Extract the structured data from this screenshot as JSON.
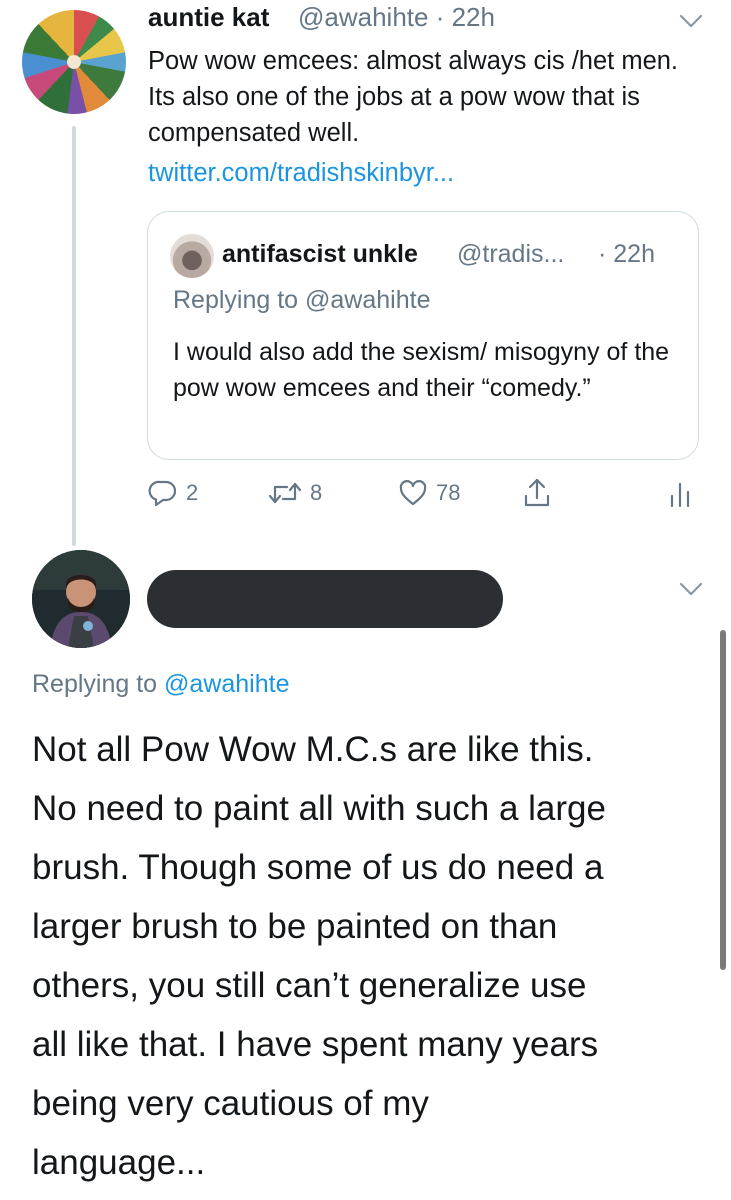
{
  "tweet1": {
    "display_name": "auntie kat",
    "handle_time": "@awahihte · 22h",
    "text": "Pow wow emcees: almost always cis /het men. Its also one of the jobs at a pow wow that is compensated well.",
    "link": "twitter.com/tradishskinbyr...",
    "quote": {
      "display_name": "antifascist unkle",
      "handle": "@tradis...",
      "time": "· 22h",
      "replying_to": "Replying to @awahihte",
      "text": "I would also add the sexism/ misogyny of the pow wow emcees and their “comedy.”"
    },
    "actions": {
      "reply_count": "2",
      "retweet_count": "8",
      "like_count": "78"
    }
  },
  "tweet2": {
    "replying_to_prefix": "Replying to ",
    "replying_to_handle": "@awahihte",
    "text": "Not all Pow Wow M.C.s are like this.\nNo need to paint all with such a large\nbrush. Though some of us do need a\nlarger brush to be painted on than\nothers, you still can’t generalize use\nall like that.  I have spent many years\nbeing very cautious of my\nlanguage..."
  },
  "colors": {
    "link_blue": "#1b95e0",
    "muted_gray": "#657786",
    "border": "#cfd9de",
    "redaction": "#2b2f33"
  },
  "icons": [
    "chevron-down-icon",
    "reply-icon",
    "retweet-icon",
    "like-icon",
    "share-icon",
    "analytics-icon"
  ]
}
